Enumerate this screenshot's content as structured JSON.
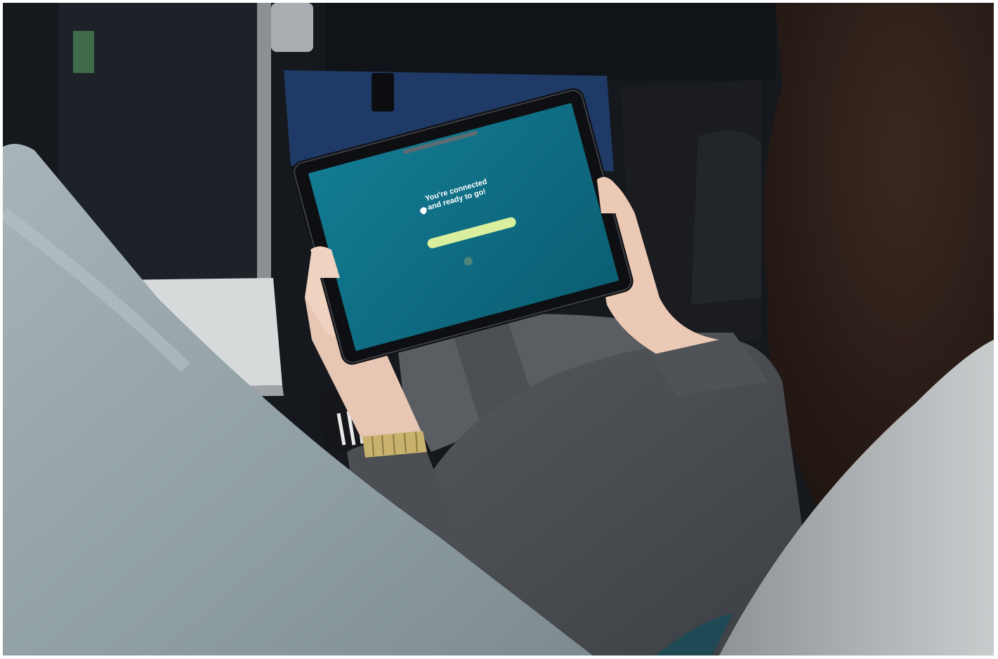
{
  "photo": {
    "description_free": true,
    "colors": {
      "seat_front": "#9aa8ad",
      "seat_right": "#b9bdbf",
      "tablet_screen": "#0f6f86",
      "tablet_bezel": "#0e0f12",
      "screen_button": "#d9ef9e",
      "jacket": "#4a4d51",
      "hair": "#2a1c17",
      "background": "#15181d"
    }
  },
  "tablet": {
    "icon": "apple-logo-icon",
    "heading_line1": "You're connected",
    "heading_line2": "and ready to go!",
    "subtext": "",
    "button_label": "",
    "progress_indicator_icon": "loading-dot-icon"
  }
}
